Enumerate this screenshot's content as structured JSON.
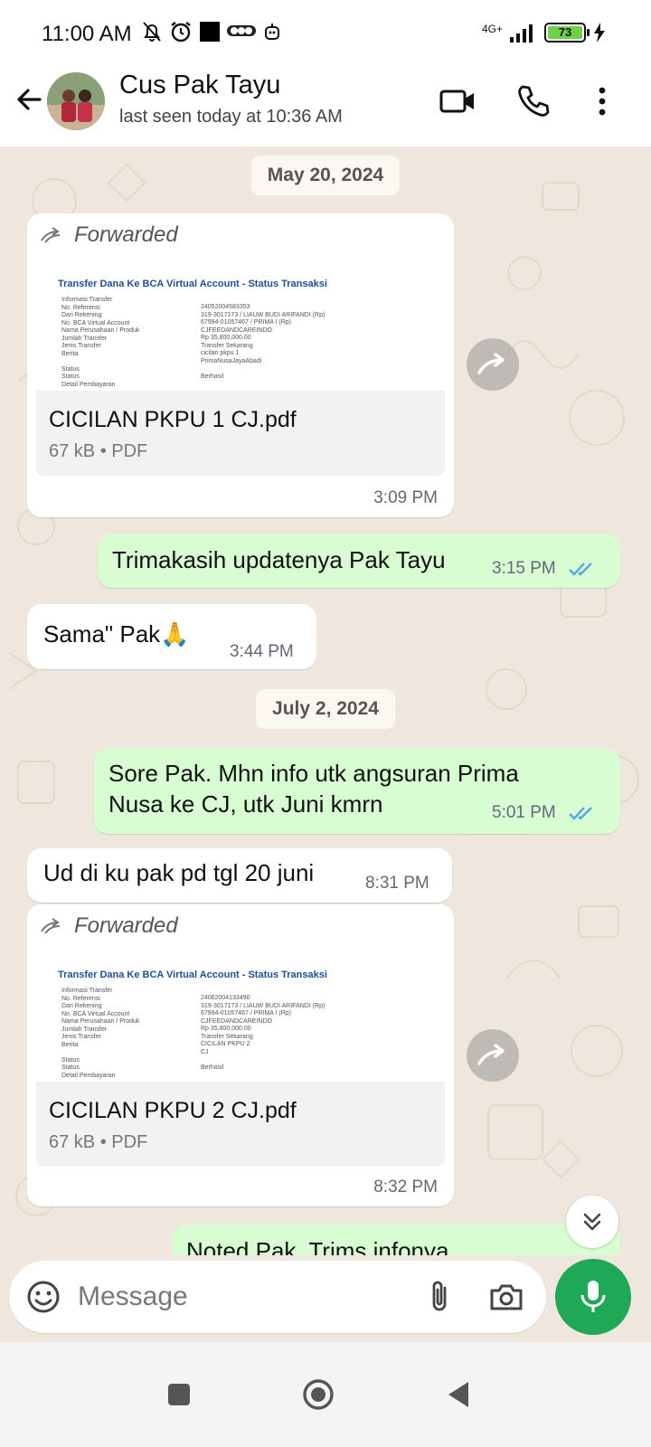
{
  "status_bar": {
    "time": "11:00 AM",
    "network": "4G+",
    "battery": "73"
  },
  "header": {
    "contact_name": "Cus Pak Tayu",
    "last_seen": "last seen today at 10:36 AM"
  },
  "chat": {
    "date_1": "May 20, 2024",
    "date_2": "July 2, 2024",
    "messages": [
      {
        "forwarded_label": "Forwarded",
        "preview_title": "Transfer Dana Ke BCA Virtual Account - Status Transaksi",
        "file_name": "CICILAN PKPU 1 CJ.pdf",
        "file_meta": "67 kB • PDF",
        "time": "3:09 PM"
      },
      {
        "text": "Trimakasih updatenya Pak Tayu",
        "time": "3:15 PM"
      },
      {
        "text": "Sama\" Pak🙏",
        "time": "3:44 PM"
      },
      {
        "text": "Sore Pak. Mhn info utk angsuran Prima Nusa ke CJ, utk Juni kmrn",
        "time": "5:01 PM"
      },
      {
        "text": "Ud di ku pak pd tgl 20 juni",
        "time": "8:31 PM"
      },
      {
        "forwarded_label": "Forwarded",
        "preview_title": "Transfer Dana Ke BCA Virtual Account - Status Transaksi",
        "file_name": "CICILAN PKPU 2 CJ.pdf",
        "file_meta": "67 kB • PDF",
        "time": "8:32 PM"
      },
      {
        "text": "Noted Pak. Trims infonya",
        "time": ""
      }
    ]
  },
  "input": {
    "placeholder": "Message",
    "value": ""
  },
  "icons": {
    "back": "arrow-left-icon",
    "video": "video-call-icon",
    "call": "phone-icon",
    "menu": "more-vertical-icon",
    "emoji": "emoji-icon",
    "attach": "paperclip-icon",
    "camera": "camera-icon",
    "mic": "microphone-icon"
  },
  "colors": {
    "chat_bg": "#efe7dd",
    "outgoing_bubble": "#d9fdd3",
    "incoming_bubble": "#ffffff",
    "accent_green": "#1fa855",
    "read_ticks": "#53a6e6"
  }
}
